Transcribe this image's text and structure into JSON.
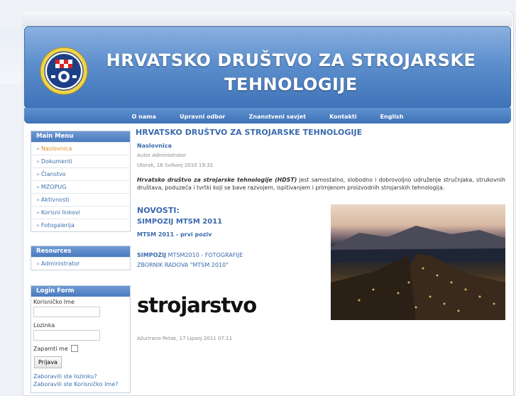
{
  "header": {
    "title": "HRVATSKO DRUŠTVO ZA STROJARSKE TEHNOLOGIJE"
  },
  "nav": [
    {
      "label": "O nama"
    },
    {
      "label": "Upravni odbor"
    },
    {
      "label": "Znanstveni savjet"
    },
    {
      "label": "Kontakti"
    },
    {
      "label": "English"
    }
  ],
  "main_menu": {
    "title": "Main Menu",
    "items": [
      {
        "label": "Naslovnica"
      },
      {
        "label": "Dokumenti"
      },
      {
        "label": "Članstvo"
      },
      {
        "label": "MZOPUG"
      },
      {
        "label": "Aktivnosti"
      },
      {
        "label": "Korisni linkovi"
      },
      {
        "label": "Fotogalerija"
      }
    ]
  },
  "resources": {
    "title": "Resources",
    "items": [
      {
        "label": "Administrator"
      }
    ]
  },
  "login": {
    "title": "Login Form",
    "username_label": "Korisničko Ime",
    "password_label": "Lozinka",
    "remember_label": "Zapamti me",
    "submit_label": "Prijava",
    "forgot_password": "Zaboravili ste lozinku?",
    "forgot_username": "Zaboravili ste Korisničko Ime?"
  },
  "article": {
    "title": "HRVATSKO DRUŠTVO ZA STROJARSKE TEHNOLOGIJE",
    "section": "Naslovnica",
    "author": "Autor Administrator",
    "date": "Utorak, 18 Svibanj 2010 19:32",
    "intro_italic": "Hrvatsko društvo za strojarske tehnologije (HDST)",
    "intro_rest": " jest samostalno, slobodno i dobrovoljno udruženje stručnjaka, strukovnih društava, poduzeća i tvrtki koji se bave razvojem, ispitivanjem i primjenom proizvodnih strojarskih tehnologija.",
    "news_heading": "NOVOSTI:",
    "simpozij_heading": "SIMPOZIJ MTSM 2011",
    "first_call": "MTSM 2011 - prvi poziv",
    "photos_bold": "SIMPOZIJ",
    "photos_rest": " MTSM2010 - FOTOGRAFIJE",
    "proceedings": "ZBORNIK RADOVA \"MTSM 2010\"",
    "banner_text": "strojarstvo",
    "updated": "Ažurirano Petak, 17 Lipanj 2011 07:11"
  }
}
